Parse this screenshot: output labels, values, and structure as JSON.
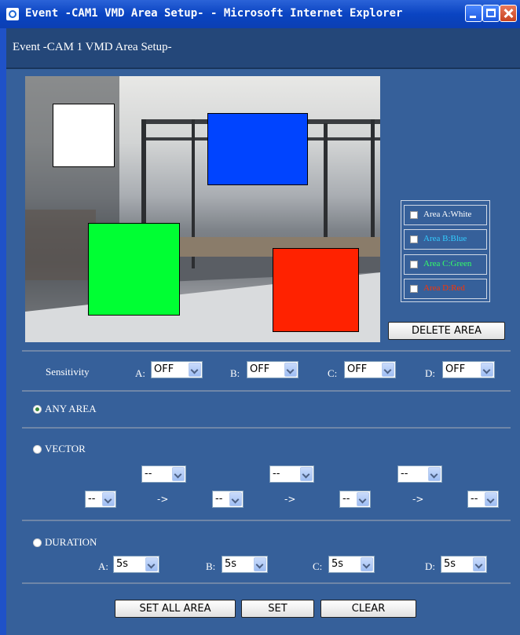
{
  "window": {
    "title": "Event -CAM1 VMD Area Setup- - Microsoft Internet Explorer"
  },
  "header": {
    "title": "Event -CAM 1  VMD Area Setup-"
  },
  "areas": [
    {
      "label": "Area A:White",
      "color": "#ffffff",
      "label_color": "#ffffff"
    },
    {
      "label": "Area B:Blue",
      "color": "#0044ff",
      "label_color": "#33ccff"
    },
    {
      "label": "Area C:Green",
      "color": "#00ff33",
      "label_color": "#33ff66"
    },
    {
      "label": "Area D:Red",
      "color": "#ff2200",
      "label_color": "#ff3300"
    }
  ],
  "buttons": {
    "delete_area": "DELETE AREA",
    "set_all_area": "SET ALL AREA",
    "set": "SET",
    "clear": "CLEAR"
  },
  "sensitivity": {
    "label": "Sensitivity",
    "items": [
      {
        "letter": "A:",
        "value": "OFF"
      },
      {
        "letter": "B:",
        "value": "OFF"
      },
      {
        "letter": "C:",
        "value": "OFF"
      },
      {
        "letter": "D:",
        "value": "OFF"
      }
    ]
  },
  "modes": {
    "any_area": "ANY AREA",
    "vector": "VECTOR",
    "duration": "DURATION",
    "selected": "any_area"
  },
  "vector": {
    "top_selects": [
      "--",
      "--",
      "--"
    ],
    "bottom_selects": [
      "--",
      "--",
      "--",
      "--"
    ],
    "arrow": "->"
  },
  "duration": {
    "items": [
      {
        "letter": "A:",
        "value": "5s"
      },
      {
        "letter": "B:",
        "value": "5s"
      },
      {
        "letter": "C:",
        "value": "5s"
      },
      {
        "letter": "D:",
        "value": "5s"
      }
    ]
  }
}
